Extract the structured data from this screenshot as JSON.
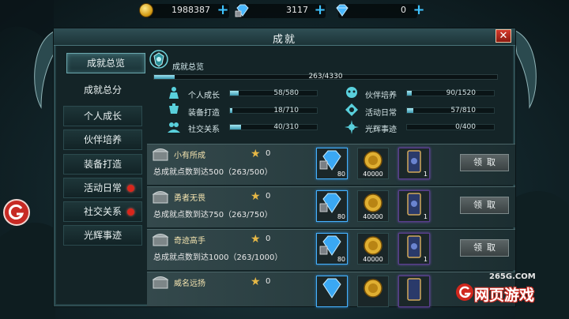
{
  "resources": {
    "gold": "1988387",
    "diamond_bound": "3117",
    "diamond": "0"
  },
  "window": {
    "title": "成就",
    "close": "✕"
  },
  "nav": {
    "items": [
      {
        "label": "成就总览",
        "active": true,
        "dot": false
      },
      {
        "label": "成就总分",
        "active": false,
        "dot": false
      },
      {
        "label": "个人成长",
        "active": false,
        "dot": false
      },
      {
        "label": "伙伴培养",
        "active": false,
        "dot": false
      },
      {
        "label": "装备打造",
        "active": false,
        "dot": false
      },
      {
        "label": "活动日常",
        "active": false,
        "dot": true
      },
      {
        "label": "社交关系",
        "active": false,
        "dot": true
      },
      {
        "label": "光辉事迹",
        "active": false,
        "dot": false
      }
    ]
  },
  "overview": {
    "title": "成就总览",
    "total": "263/4330",
    "total_fraction": 0.0607,
    "categories": [
      {
        "label": "个人成长",
        "value": "58/580",
        "fraction": 0.1
      },
      {
        "label": "伙伴培养",
        "value": "90/1520",
        "fraction": 0.059
      },
      {
        "label": "装备打造",
        "value": "18/710",
        "fraction": 0.025
      },
      {
        "label": "活动日常",
        "value": "57/810",
        "fraction": 0.07
      },
      {
        "label": "社交关系",
        "value": "40/310",
        "fraction": 0.129
      },
      {
        "label": "光辉事迹",
        "value": "0/400",
        "fraction": 0.0
      }
    ]
  },
  "achievements": [
    {
      "name": "小有所成",
      "points": "0",
      "desc": "总成就点数到达500（263/500）",
      "gem_qty": "80",
      "coin_qty": "40000",
      "card_qty": "1",
      "claim": "领取"
    },
    {
      "name": "勇者无畏",
      "points": "0",
      "desc": "总成就点数到达750（263/750）",
      "gem_qty": "80",
      "coin_qty": "40000",
      "card_qty": "1",
      "claim": "领取"
    },
    {
      "name": "奇迹高手",
      "points": "0",
      "desc": "总成就点数到达1000（263/1000）",
      "gem_qty": "80",
      "coin_qty": "40000",
      "card_qty": "1",
      "claim": "领取"
    },
    {
      "name": "威名远扬",
      "points": "0",
      "desc": "",
      "gem_qty": "",
      "coin_qty": "",
      "card_qty": "",
      "claim": ""
    }
  ],
  "watermark": {
    "domain": "265G.COM",
    "text": "网页游戏"
  },
  "colors": {
    "accent": "#3fc3ff",
    "panel": "#142427",
    "red_dot": "#d8261c",
    "close_red": "#d53a2c"
  }
}
